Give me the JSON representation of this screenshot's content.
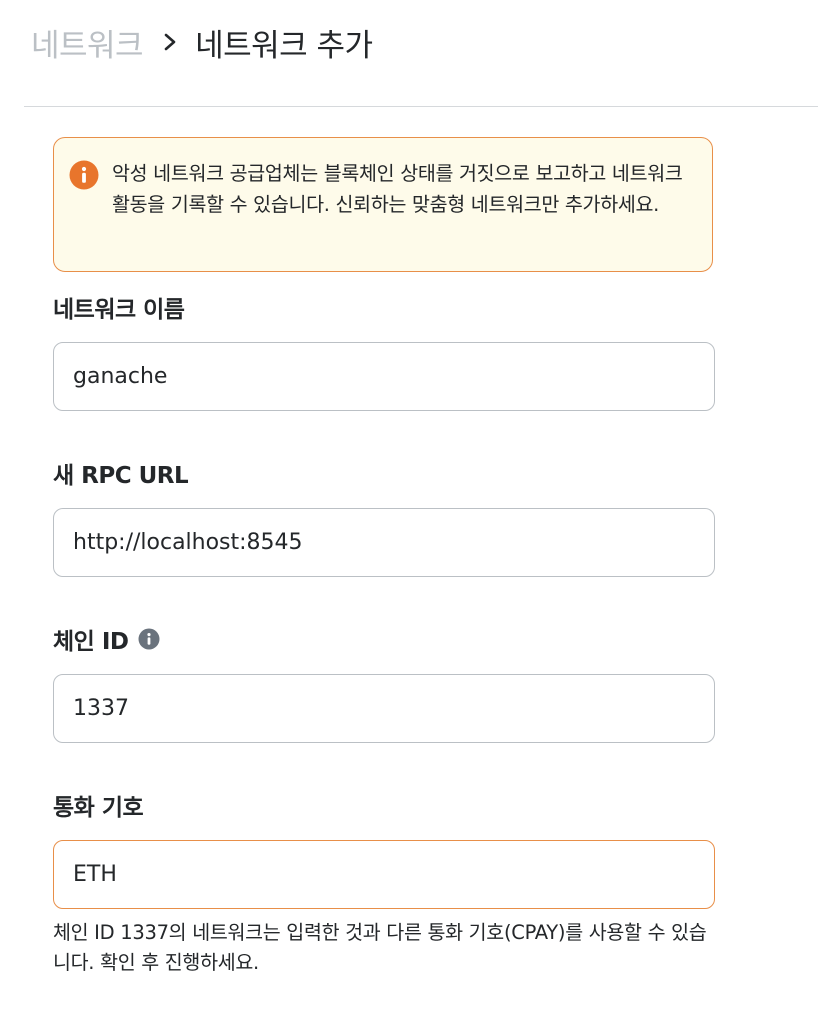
{
  "breadcrumb": {
    "parent": "네트워크",
    "current": "네트워크 추가"
  },
  "warning": {
    "text": "악성 네트워크 공급업체는 블록체인 상태를 거짓으로 보고하고 네트워크 활동을 기록할 수 있습니다. 신뢰하는 맞춤형 네트워크만 추가하세요.",
    "icon": "info-circle-icon",
    "icon_color": "#e8752c"
  },
  "fields": {
    "network_name": {
      "label": "네트워크 이름",
      "value": "ganache"
    },
    "rpc_url": {
      "label": "새 RPC URL",
      "value": "http://localhost:8545"
    },
    "chain_id": {
      "label": "체인 ID",
      "value": "1337",
      "info_icon": "info-icon"
    },
    "currency_symbol": {
      "label": "통화 기호",
      "value": "ETH",
      "helper": "체인 ID 1337의 네트워크는 입력한 것과 다른 통화 기호(CPAY)를 사용할 수 있습니다. 확인 후 진행하세요."
    }
  },
  "colors": {
    "warning_border": "#e88f49",
    "warning_background": "#fefbea",
    "muted_text": "#bbc0c5"
  }
}
